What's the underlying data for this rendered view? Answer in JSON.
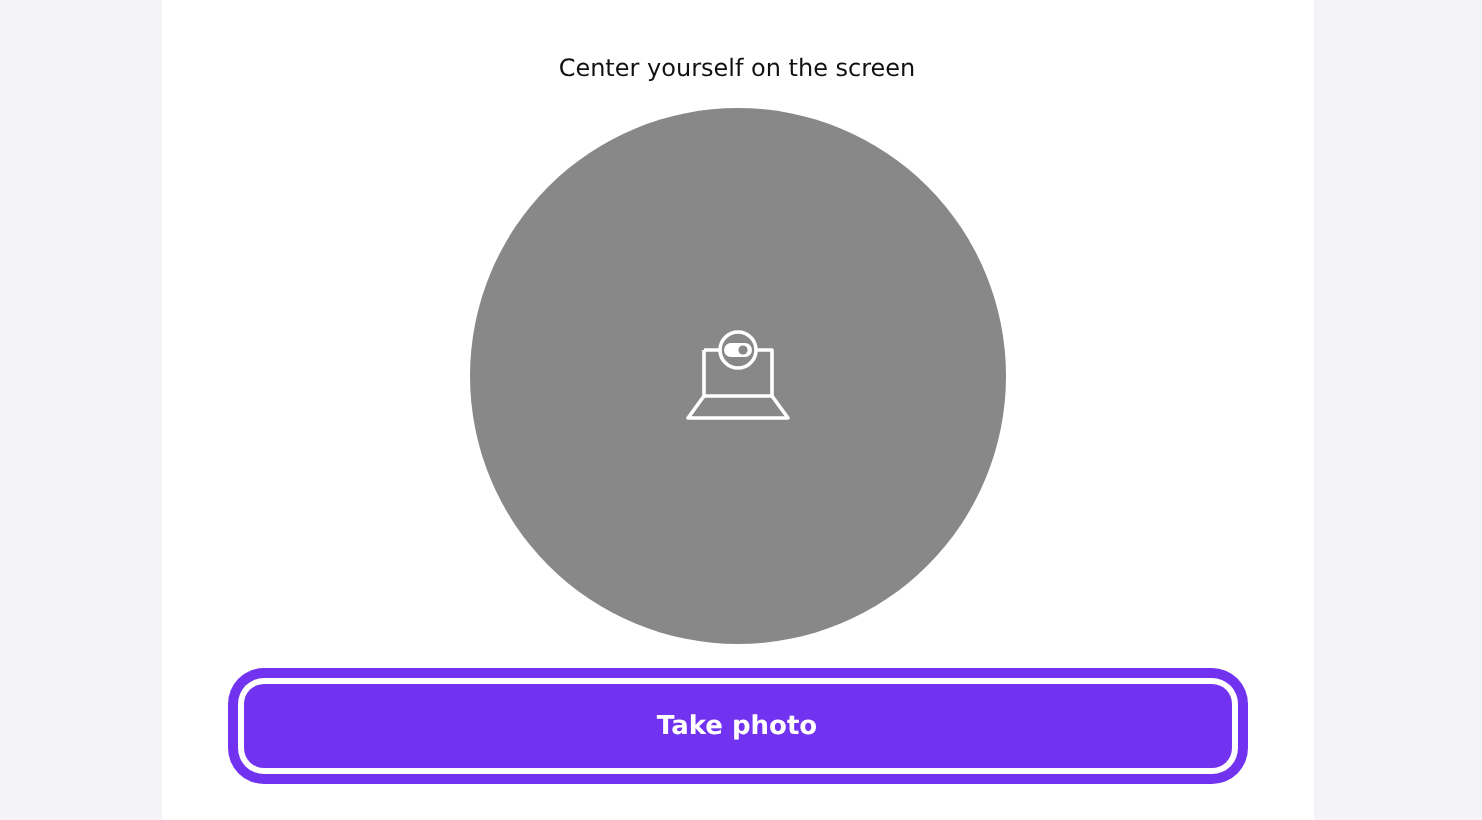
{
  "instruction": "Center yourself on the screen",
  "camera_preview": {
    "kind": "placeholder"
  },
  "primary_button": {
    "label": "Take photo"
  }
}
